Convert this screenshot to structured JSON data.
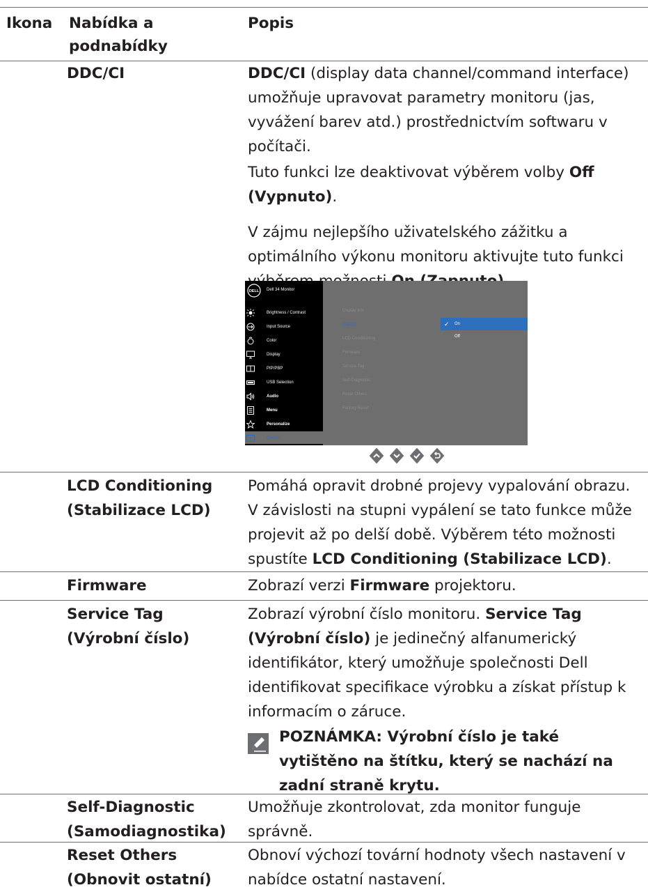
{
  "header": {
    "col_icon": "Ikona",
    "col_menu_line1": "Nabídka a",
    "col_menu_line2": "podnabídky",
    "col_desc": "Popis"
  },
  "rows": {
    "ddc": {
      "name": "DDC/CI",
      "p1_bold": "DDC/CI",
      "p1_l1": " (display data channel/command interface)",
      "p1_l2": "umožňuje upravovat parametry monitoru (jas,",
      "p1_l3": "vyvážení barev atd.) prostřednictvím softwaru v",
      "p1_l4": "počítači.",
      "p2_l1": "Tuto funkci lze deaktivovat výběrem volby ",
      "p2_b1": "Off",
      "p2_b2": "(Vypnuto)",
      "p2_end": ".",
      "p3_l1": "V zájmu nejlepšího uživatelského zážitku a",
      "p3_l2": "optimálního výkonu monitoru aktivujte tuto funkci",
      "p3_l3": "výběrem možnosti ",
      "p3_b": "On (Zapnuto)",
      "p3_end": "."
    },
    "lcd": {
      "name_l1": "LCD Conditioning",
      "name_l2": "(Stabilizace LCD)",
      "l1": "Pomáhá opravit drobné projevy vypalování obrazu.",
      "l2": "V závislosti na stupni vypálení se tato funkce může",
      "l3": "projevit až po delší době. Výběrem této možnosti",
      "l4": "spustíte ",
      "l4_b": "LCD Conditioning (Stabilizace LCD)",
      "l4_end": "."
    },
    "fw": {
      "name": "Firmware",
      "t1": "Zobrazí verzi ",
      "tb": "Firmware",
      "t2": " projektoru."
    },
    "st": {
      "name_l1": "Service Tag",
      "name_l2": "(Výrobní číslo)",
      "l1": "Zobrazí výrobní číslo monitoru. ",
      "l1_b": "Service Tag",
      "l2_b": "(Výrobní číslo)",
      "l2": " je jedinečný alfanumerický",
      "l3": "identifikátor, který umožňuje společnosti Dell",
      "l4": "identifikovat specifikace výrobku a získat přístup k",
      "l5": "informacím o záruce.",
      "note_l1": "POZNÁMKA: Výrobní číslo je také",
      "note_l2": "vytištěno na štítku, který se nachází na",
      "note_l3": "zadní straně krytu."
    },
    "sd": {
      "name_l1": "Self-Diagnostic",
      "name_l2": "(Samodiagnostika)",
      "l1": "Umožňuje zkontrolovat, zda monitor funguje",
      "l2": "správně."
    },
    "ro": {
      "name_l1": "Reset Others",
      "name_l2": "(Obnovit ostatní)",
      "l1": "Obnoví výchozí tovární hodnoty všech nastavení v",
      "l2": "nabídce ostatní nastavení."
    }
  },
  "osd": {
    "logo": "DELL",
    "title": "Dell 34 Monitor",
    "menu": [
      {
        "label": "Brightness / Contrast",
        "icon": "brightness-icon"
      },
      {
        "label": "Input Source",
        "icon": "input-source-icon"
      },
      {
        "label": "Color",
        "icon": "color-icon"
      },
      {
        "label": "Display",
        "icon": "display-icon"
      },
      {
        "label": "PIP/PBP",
        "icon": "pip-icon"
      },
      {
        "label": "USB Selection",
        "icon": "usb-icon"
      },
      {
        "label": "Audio",
        "icon": "audio-icon"
      },
      {
        "label": "Menu",
        "icon": "menu-icon"
      },
      {
        "label": "Personalize",
        "icon": "star-icon"
      },
      {
        "label": "Others",
        "icon": "others-icon"
      }
    ],
    "sub": [
      "Display Info",
      "DDC/CI",
      "LCD Conditioning",
      "Firmware",
      "Service Tag",
      "Self-Diagnostic",
      "Reset Others",
      "Factory Reset"
    ],
    "opt_on": "On",
    "opt_off": "Off",
    "check": "✓",
    "selected_color": "#2e6fbd"
  }
}
